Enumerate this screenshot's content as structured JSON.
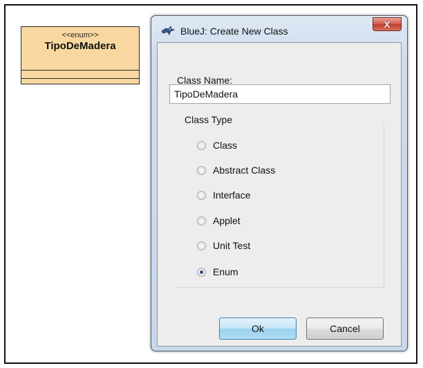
{
  "uml": {
    "stereotype": "<<enum>>",
    "class_name": "TipoDeMadera"
  },
  "dialog": {
    "title": "BlueJ:  Create New Class",
    "close_label": "X",
    "class_name_label": "Class Name:",
    "class_name_value": "TipoDeMadera",
    "class_type_label": "Class Type",
    "class_types": [
      {
        "label": "Class",
        "selected": false
      },
      {
        "label": "Abstract Class",
        "selected": false
      },
      {
        "label": "Interface",
        "selected": false
      },
      {
        "label": "Applet",
        "selected": false
      },
      {
        "label": "Unit Test",
        "selected": false
      },
      {
        "label": "Enum",
        "selected": true
      }
    ],
    "ok_label": "Ok",
    "cancel_label": "Cancel"
  },
  "colors": {
    "uml_fill": "#f8d8a0",
    "dialog_frame": "#cfdced",
    "ok_button": "#98d1ef",
    "close_button": "#c03c2b"
  },
  "icons": [
    "bluej-bird-icon",
    "close-icon",
    "radio-icon"
  ]
}
